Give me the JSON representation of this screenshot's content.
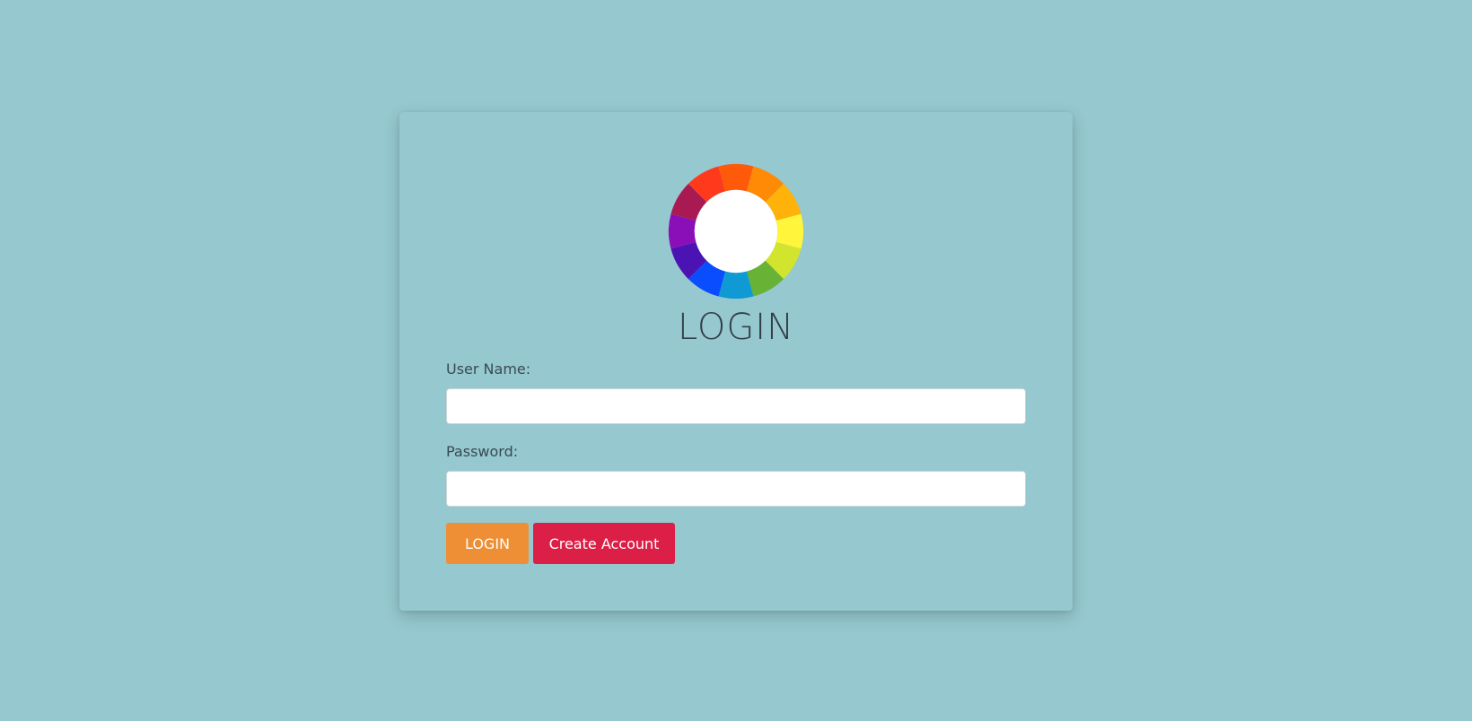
{
  "login_card": {
    "title": "LOGIN",
    "logo": {
      "icon": "color-wheel-icon",
      "segment_colors": [
        "#ff3a1c",
        "#ff5a0a",
        "#ff8a06",
        "#ffb20a",
        "#fff53a",
        "#d3e42e",
        "#68b236",
        "#0f9ad4",
        "#0a4dff",
        "#4b12b4",
        "#8a0fb8",
        "#aa1a52"
      ]
    },
    "username": {
      "label": "User Name:",
      "value": "",
      "placeholder": ""
    },
    "password": {
      "label": "Password:",
      "value": "",
      "placeholder": ""
    },
    "buttons": {
      "login_label": "LOGIN",
      "create_account_label": "Create Account"
    }
  },
  "colors": {
    "background": "#95c8cf",
    "login_button": "#ee8f36",
    "create_account_button": "#dc1f47",
    "title_text": "#333f48"
  }
}
